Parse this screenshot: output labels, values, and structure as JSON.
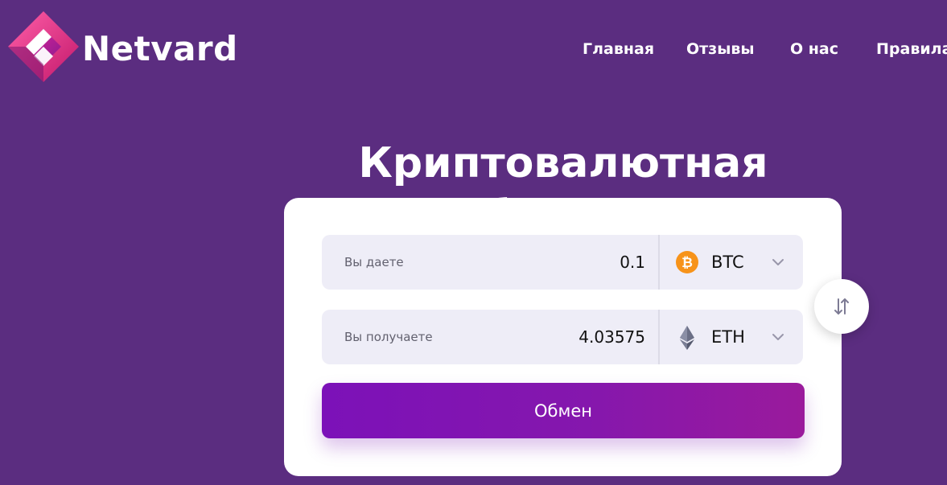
{
  "brand": {
    "name": "Netvard",
    "logo_icon": "diamond-logo-icon"
  },
  "nav": {
    "items": [
      {
        "label": "Главная"
      },
      {
        "label": "Отзывы"
      },
      {
        "label": "О нас"
      },
      {
        "label": "Правила"
      }
    ]
  },
  "hero": {
    "title": "Криптовалютная биржа"
  },
  "exchange": {
    "give": {
      "label": "Вы даете",
      "value": "0.1",
      "currency": "BTC",
      "icon": "bitcoin-icon"
    },
    "get": {
      "label": "Вы получаете",
      "value": "4.03575",
      "currency": "ETH",
      "icon": "ethereum-icon"
    },
    "swap_icon": "swap-arrows-icon",
    "submit_label": "Обмен"
  },
  "colors": {
    "background": "#5b2d80",
    "field_bg": "#eeedf7",
    "button_gradient_start": "#7c11b8",
    "button_gradient_end": "#9a1a9c",
    "bitcoin": "#f7931a"
  }
}
